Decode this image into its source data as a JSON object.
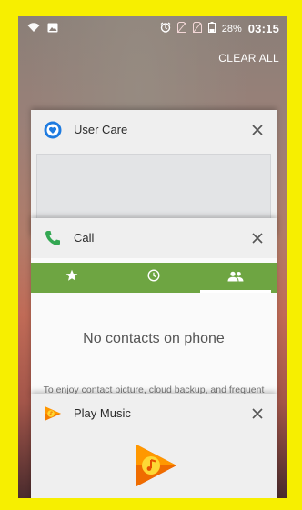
{
  "status_bar": {
    "battery_percent": "28%",
    "time": "03:15"
  },
  "recents": {
    "clear_all_label": "CLEAR ALL"
  },
  "cards": {
    "user_care": {
      "title": "User Care"
    },
    "call": {
      "title": "Call",
      "tabs": [
        "favorites-star-icon",
        "recent-clock-icon",
        "contacts-people-icon"
      ],
      "active_tab": 2,
      "empty_title": "No contacts on phone",
      "empty_hint": "To enjoy contact picture, cloud backup, and frequent contacts suggestions, we invite you to"
    },
    "play_music": {
      "title": "Play Music"
    }
  },
  "colors": {
    "highlight_frame": "#f7ef00",
    "call_tab_bar": "#6ea542",
    "play_music_orange": "#f57c00"
  }
}
